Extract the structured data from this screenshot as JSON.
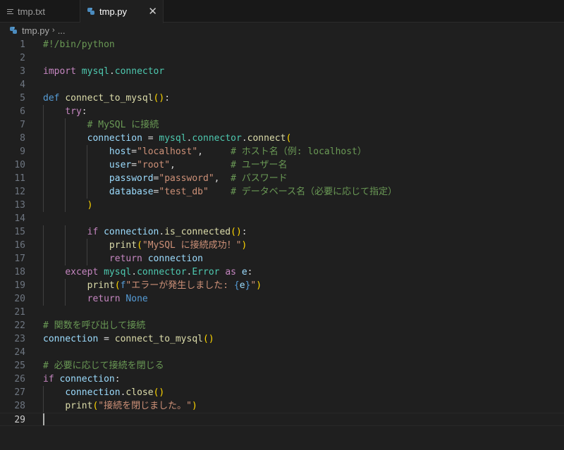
{
  "tabs": [
    {
      "label": "tmp.txt",
      "icon": "text-file-icon",
      "active": false
    },
    {
      "label": "tmp.py",
      "icon": "python-icon",
      "active": true,
      "close": "✕"
    }
  ],
  "breadcrumb": {
    "file": "tmp.py",
    "separator": "›",
    "more": "..."
  },
  "editor": {
    "current_line": 29,
    "lines": [
      [
        [
          "cm",
          "#!/bin/python"
        ]
      ],
      [],
      [
        [
          "kw",
          "import"
        ],
        [
          "tx",
          " "
        ],
        [
          "cl",
          "mysql"
        ],
        [
          "tx",
          "."
        ],
        [
          "cl",
          "connector"
        ]
      ],
      [],
      [
        [
          "kb",
          "def"
        ],
        [
          "tx",
          " "
        ],
        [
          "fn",
          "connect_to_mysql"
        ],
        [
          "p1",
          "()"
        ],
        [
          "tx",
          ":"
        ]
      ],
      [
        [
          "ws",
          "    "
        ],
        [
          "kw",
          "try"
        ],
        [
          "tx",
          ":"
        ]
      ],
      [
        [
          "ws",
          "        "
        ],
        [
          "cm",
          "# MySQL に接続"
        ]
      ],
      [
        [
          "ws",
          "        "
        ],
        [
          "vr",
          "connection"
        ],
        [
          "tx",
          " = "
        ],
        [
          "cl",
          "mysql"
        ],
        [
          "tx",
          "."
        ],
        [
          "cl",
          "connector"
        ],
        [
          "tx",
          "."
        ],
        [
          "fn",
          "connect"
        ],
        [
          "p1",
          "("
        ]
      ],
      [
        [
          "ws",
          "            "
        ],
        [
          "vr",
          "host"
        ],
        [
          "tx",
          "="
        ],
        [
          "st",
          "\"localhost\""
        ],
        [
          "tx",
          ",     "
        ],
        [
          "cm",
          "# ホスト名（例: localhost）"
        ]
      ],
      [
        [
          "ws",
          "            "
        ],
        [
          "vr",
          "user"
        ],
        [
          "tx",
          "="
        ],
        [
          "st",
          "\"root\""
        ],
        [
          "tx",
          ",          "
        ],
        [
          "cm",
          "# ユーザー名"
        ]
      ],
      [
        [
          "ws",
          "            "
        ],
        [
          "vr",
          "password"
        ],
        [
          "tx",
          "="
        ],
        [
          "st",
          "\"password\""
        ],
        [
          "tx",
          ",  "
        ],
        [
          "cm",
          "# パスワード"
        ]
      ],
      [
        [
          "ws",
          "            "
        ],
        [
          "vr",
          "database"
        ],
        [
          "tx",
          "="
        ],
        [
          "st",
          "\"test_db\""
        ],
        [
          "tx",
          "    "
        ],
        [
          "cm",
          "# データベース名（必要に応じて指定）"
        ]
      ],
      [
        [
          "ws",
          "        "
        ],
        [
          "p1",
          ")"
        ]
      ],
      [],
      [
        [
          "ws",
          "        "
        ],
        [
          "kw",
          "if"
        ],
        [
          "tx",
          " "
        ],
        [
          "vr",
          "connection"
        ],
        [
          "tx",
          "."
        ],
        [
          "fn",
          "is_connected"
        ],
        [
          "p1",
          "()"
        ],
        [
          "tx",
          ":"
        ]
      ],
      [
        [
          "ws",
          "            "
        ],
        [
          "fn",
          "print"
        ],
        [
          "p1",
          "("
        ],
        [
          "st",
          "\"MySQL に接続成功！\""
        ],
        [
          "p1",
          ")"
        ]
      ],
      [
        [
          "ws",
          "            "
        ],
        [
          "kw",
          "return"
        ],
        [
          "tx",
          " "
        ],
        [
          "vr",
          "connection"
        ]
      ],
      [
        [
          "ws",
          "    "
        ],
        [
          "kw",
          "except"
        ],
        [
          "tx",
          " "
        ],
        [
          "cl",
          "mysql"
        ],
        [
          "tx",
          "."
        ],
        [
          "cl",
          "connector"
        ],
        [
          "tx",
          "."
        ],
        [
          "cl",
          "Error"
        ],
        [
          "tx",
          " "
        ],
        [
          "kw",
          "as"
        ],
        [
          "tx",
          " "
        ],
        [
          "vr",
          "e"
        ],
        [
          "tx",
          ":"
        ]
      ],
      [
        [
          "ws",
          "        "
        ],
        [
          "fn",
          "print"
        ],
        [
          "p1",
          "("
        ],
        [
          "kb",
          "f"
        ],
        [
          "st",
          "\"エラーが発生しました: "
        ],
        [
          "kb",
          "{"
        ],
        [
          "vr",
          "e"
        ],
        [
          "kb",
          "}"
        ],
        [
          "st",
          "\""
        ],
        [
          "p1",
          ")"
        ]
      ],
      [
        [
          "ws",
          "        "
        ],
        [
          "kw",
          "return"
        ],
        [
          "tx",
          " "
        ],
        [
          "kb",
          "None"
        ]
      ],
      [],
      [
        [
          "cm",
          "# 関数を呼び出して接続"
        ]
      ],
      [
        [
          "vr",
          "connection"
        ],
        [
          "tx",
          " = "
        ],
        [
          "fn",
          "connect_to_mysql"
        ],
        [
          "p1",
          "()"
        ]
      ],
      [],
      [
        [
          "cm",
          "# 必要に応じて接続を閉じる"
        ]
      ],
      [
        [
          "kw",
          "if"
        ],
        [
          "tx",
          " "
        ],
        [
          "vr",
          "connection"
        ],
        [
          "tx",
          ":"
        ]
      ],
      [
        [
          "ws",
          "    "
        ],
        [
          "vr",
          "connection"
        ],
        [
          "tx",
          "."
        ],
        [
          "fn",
          "close"
        ],
        [
          "p1",
          "()"
        ]
      ],
      [
        [
          "ws",
          "    "
        ],
        [
          "fn",
          "print"
        ],
        [
          "p1",
          "("
        ],
        [
          "st",
          "\"接続を閉じました。\""
        ],
        [
          "p1",
          ")"
        ]
      ],
      []
    ]
  }
}
